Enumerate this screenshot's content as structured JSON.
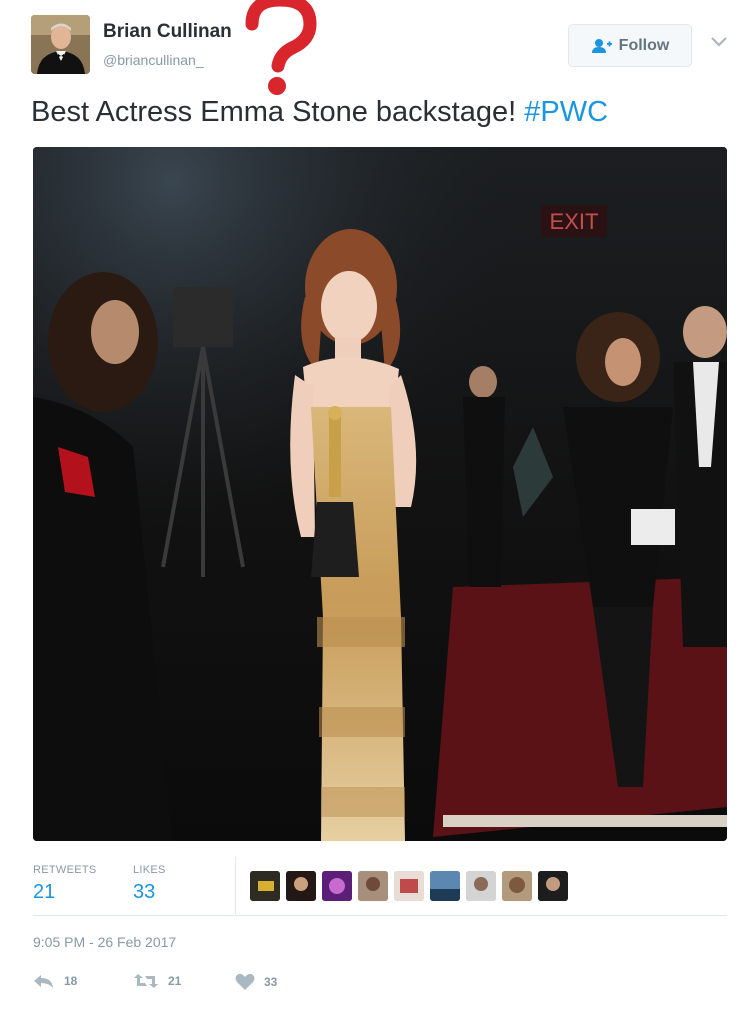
{
  "user": {
    "display_name": "Brian Cullinan",
    "handle": "@briancullinan_",
    "avatar_icon": "profile-avatar"
  },
  "follow_button": {
    "label": "Follow",
    "icon": "add-person-icon"
  },
  "tweet": {
    "text": "Best Actress Emma Stone backstage! ",
    "hashtag": "#PWC"
  },
  "photo": {
    "sign_text": "EXIT"
  },
  "stats": {
    "retweets_label": "RETWEETS",
    "retweets_count": "21",
    "likes_label": "LIKES",
    "likes_count": "33",
    "liker_avatars": 9
  },
  "timestamp": "9:05 PM - 26 Feb 2017",
  "actions": {
    "reply_count": "18",
    "retweet_count": "21",
    "like_count": "33"
  },
  "colors": {
    "link": "#1b95e0",
    "muted": "#8899a6",
    "annotation": "#d8262c"
  }
}
